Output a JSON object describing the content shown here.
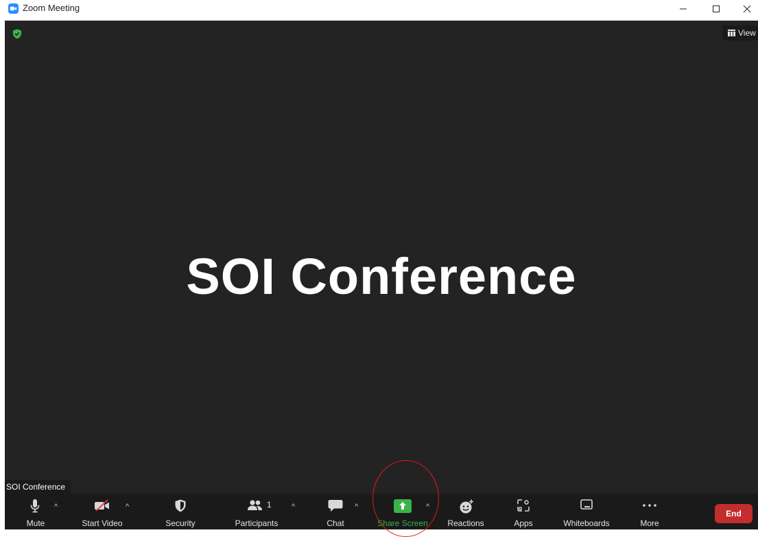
{
  "window": {
    "title": "Zoom Meeting"
  },
  "stage": {
    "headline": "SOI Conference",
    "name_tag": "SOI Conference",
    "view_label": "View"
  },
  "toolbar": {
    "mute": "Mute",
    "start_video": "Start Video",
    "security": "Security",
    "participants": "Participants",
    "participants_count": "1",
    "chat": "Chat",
    "share_screen": "Share Screen",
    "reactions": "Reactions",
    "apps": "Apps",
    "whiteboards": "Whiteboards",
    "more": "More",
    "end": "End"
  },
  "colors": {
    "stage_bg": "#232323",
    "toolbar_bg": "#1a1a1a",
    "share_green": "#3bb34a",
    "end_red": "#c22d2d",
    "shield_green": "#3bb34a"
  }
}
